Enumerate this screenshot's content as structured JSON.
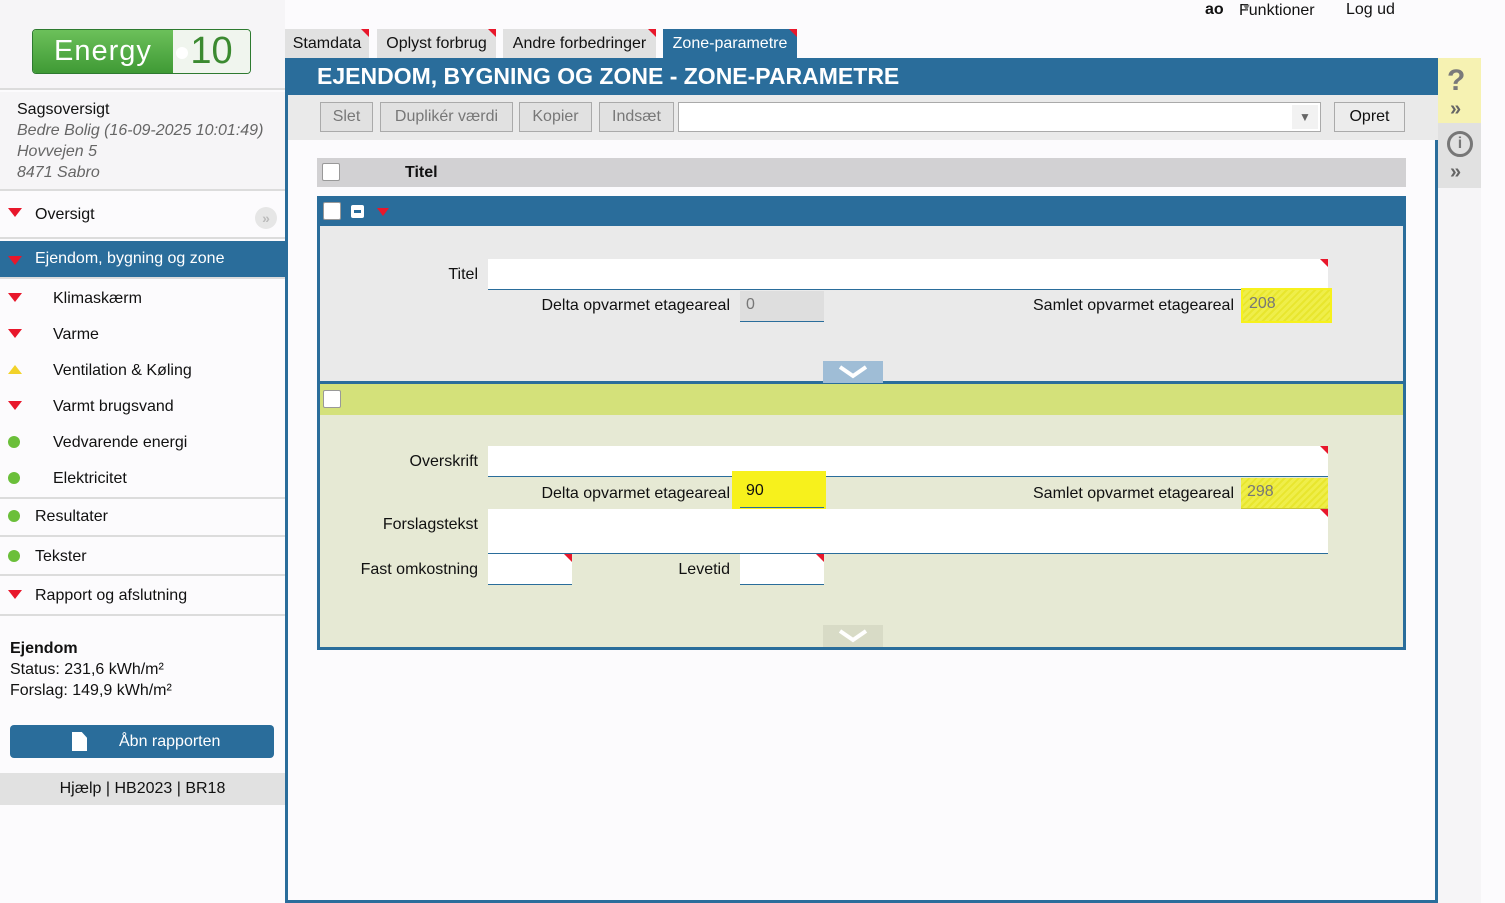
{
  "top_links": {
    "user": "ao",
    "functions": "Funktioner",
    "logout": "Log ud"
  },
  "logo": {
    "left": "Energy",
    "right": "10"
  },
  "case": {
    "title": "Sagsoversigt",
    "line1": "Bedre Bolig (16-09-2025 10:01:49)",
    "line2": "Hovvejen 5",
    "line3": "8471 Sabro"
  },
  "nav": {
    "overview": "Oversigt",
    "property": "Ejendom, bygning og zone",
    "climate": "Klimaskærm",
    "heat": "Varme",
    "ventilation": "Ventilation & Køling",
    "hot_water": "Varmt brugsvand",
    "renewable": "Vedvarende energi",
    "electricity": "Elektricitet",
    "results": "Resultater",
    "texts": "Tekster",
    "report": "Rapport og afslutning"
  },
  "summary": {
    "title": "Ejendom",
    "status": "Status: 231,6 kWh/m²",
    "proposal": "Forslag: 149,9 kWh/m²"
  },
  "report_button": "Åbn rapporten",
  "footer_links": "Hjælp | HB2023 | BR18",
  "tabs": [
    "Stamdata",
    "Oplyst forbrug",
    "Andre forbedringer",
    "Zone-parametre"
  ],
  "panel_title": "EJENDOM, BYGNING OG ZONE - ZONE-PARAMETRE",
  "toolbar": {
    "delete": "Slet",
    "duplicate": "Duplikér værdi",
    "copy": "Kopier",
    "paste": "Indsæt",
    "create": "Opret",
    "select_value": ""
  },
  "list_header": "Titel",
  "block1": {
    "title_label": "Titel",
    "title_value": "",
    "delta_label": "Delta opvarmet etageareal",
    "delta_value": "0",
    "total_label": "Samlet opvarmet etageareal",
    "total_value": "208"
  },
  "block2": {
    "heading_label": "Overskrift",
    "heading_value": "",
    "delta_label": "Delta opvarmet etageareal",
    "delta_value": "90",
    "total_label": "Samlet opvarmet etageareal",
    "total_value": "298",
    "proposal_label": "Forslagstekst",
    "proposal_value": "",
    "fixed_cost_label": "Fast omkostning",
    "fixed_cost_value": "",
    "lifetime_label": "Levetid",
    "lifetime_value": ""
  },
  "colors": {
    "brand_blue": "#2a6d9b",
    "status_red": "#e8172b",
    "status_yellow": "#f2d22a",
    "status_green": "#6bbf3a",
    "highlight": "#f7f11c",
    "block2_head": "#d4e17a"
  }
}
